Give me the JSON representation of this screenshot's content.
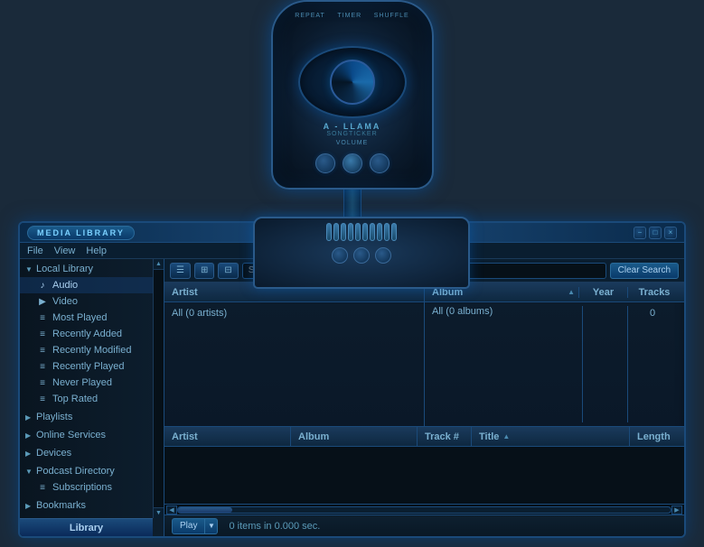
{
  "player": {
    "labels": {
      "repeat": "REPEAT",
      "timer": "TIMER",
      "shuffle": "SHUFFLE",
      "title": "A - LLAMA",
      "subtitle": "SONGTICKER",
      "volume": "VOLUME"
    }
  },
  "window": {
    "title": "MEDIA LIBRARY",
    "controls": [
      "_",
      "□",
      "×"
    ],
    "win_btn_labels": [
      "−",
      "□",
      "×"
    ]
  },
  "menu": {
    "items": [
      "File",
      "View",
      "Help"
    ]
  },
  "toolbar": {
    "clear_search_label": "Clear Search",
    "tracks_label": "Tracks"
  },
  "sidebar": {
    "sections": [
      {
        "label": "Local Library",
        "expanded": true,
        "items": [
          {
            "label": "Audio",
            "icon": "♪",
            "active": true
          },
          {
            "label": "Video",
            "icon": "▶"
          },
          {
            "label": "Most Played",
            "icon": "≡"
          },
          {
            "label": "Recently Added",
            "icon": "≡"
          },
          {
            "label": "Recently Modified",
            "icon": "≡"
          },
          {
            "label": "Recently Played",
            "icon": "≡"
          },
          {
            "label": "Never Played",
            "icon": "≡"
          },
          {
            "label": "Top Rated",
            "icon": "≡"
          }
        ]
      },
      {
        "label": "Playlists",
        "expanded": false,
        "items": []
      },
      {
        "label": "Online Services",
        "expanded": false,
        "items": []
      },
      {
        "label": "Devices",
        "expanded": false,
        "items": []
      },
      {
        "label": "Podcast Directory",
        "expanded": true,
        "items": [
          {
            "label": "Subscriptions",
            "icon": "≡"
          }
        ]
      },
      {
        "label": "Bookmarks",
        "expanded": false,
        "items": []
      }
    ],
    "library_tab": "Library"
  },
  "browser": {
    "artist_header": "Artist",
    "artist_value": "All (0 artists)",
    "album_header": "Album",
    "album_value": "All (0 albums)",
    "year_header": "Year",
    "year_value": "",
    "tracks_header": "Tracks",
    "tracks_value": "0"
  },
  "tracklist": {
    "columns": [
      {
        "label": "Artist",
        "key": "artist"
      },
      {
        "label": "Album",
        "key": "album"
      },
      {
        "label": "Track #",
        "key": "tracknum"
      },
      {
        "label": "Title",
        "key": "title"
      },
      {
        "label": "Length",
        "key": "length"
      }
    ],
    "rows": []
  },
  "statusbar": {
    "play_label": "Play",
    "status_text": "0 items in 0.000 sec."
  }
}
